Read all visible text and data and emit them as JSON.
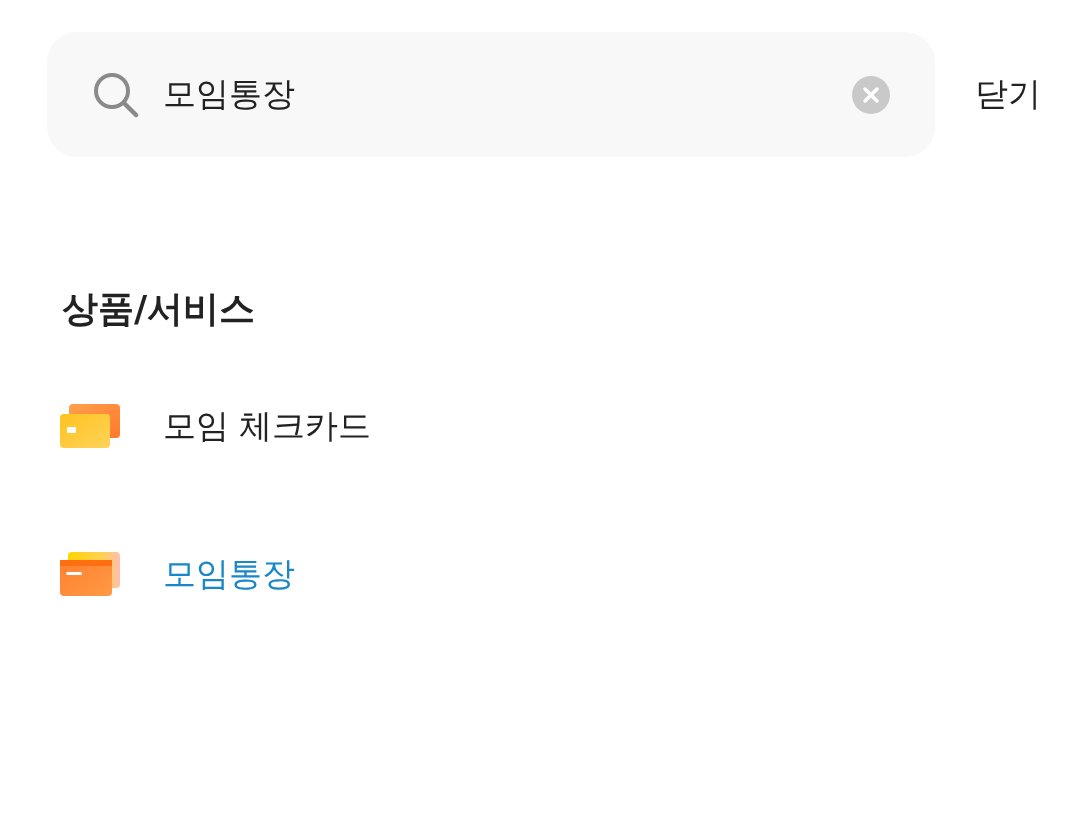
{
  "search": {
    "value": "모임통장"
  },
  "close_button": {
    "label": "닫기"
  },
  "section": {
    "title": "상품/서비스",
    "items": [
      {
        "kind": "card",
        "label": "모임 체크카드",
        "highlighted": false
      },
      {
        "kind": "account",
        "label": "모임통장",
        "highlighted": true
      }
    ]
  }
}
